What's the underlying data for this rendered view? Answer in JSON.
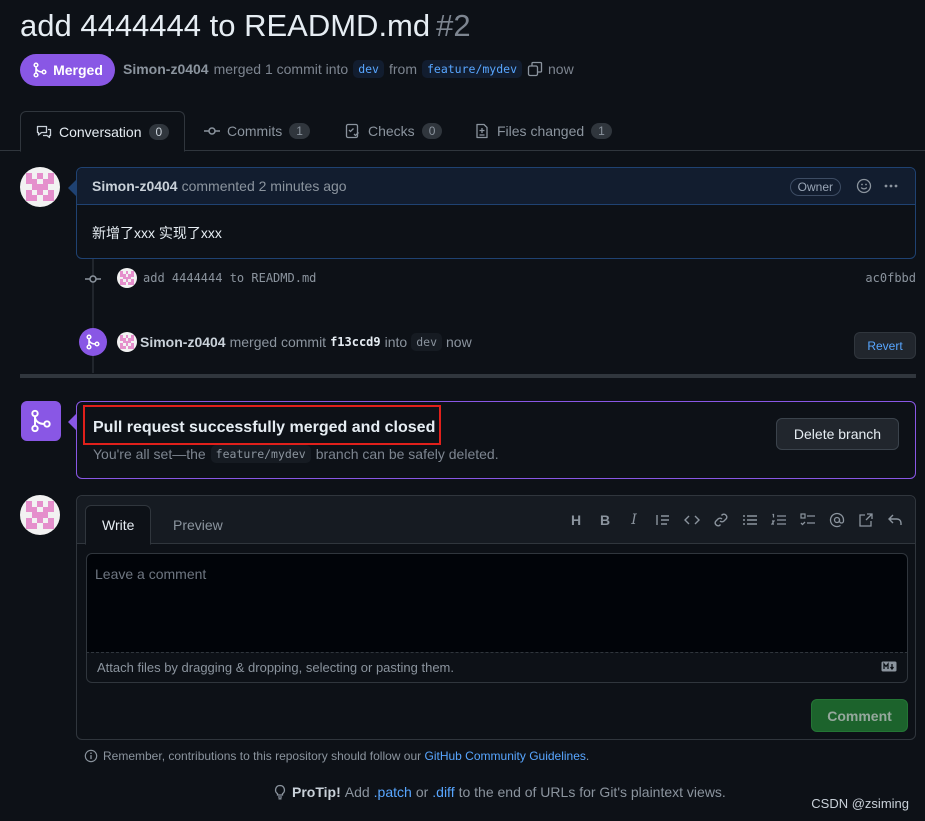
{
  "pr": {
    "title": "add 4444444 to READMD.md",
    "number": "#2",
    "state_label": "Merged",
    "author": "Simon-z0404",
    "merged_text": "merged 1 commit into",
    "base_branch": "dev",
    "from_text": "from",
    "head_branch": "feature/mydev",
    "time": "now"
  },
  "tabs": [
    {
      "label": "Conversation",
      "count": "0"
    },
    {
      "label": "Commits",
      "count": "1"
    },
    {
      "label": "Checks",
      "count": "0"
    },
    {
      "label": "Files changed",
      "count": "1"
    }
  ],
  "comment": {
    "author": "Simon-z0404",
    "action": "commented 2 minutes ago",
    "role_badge": "Owner",
    "body": "新增了xxx 实现了xxx"
  },
  "commit": {
    "message": "add 4444444 to READMD.md",
    "sha": "ac0fbbd"
  },
  "merge_event": {
    "author": "Simon-z0404",
    "text_merged": "merged commit",
    "sha": "f13ccd9",
    "text_into": "into",
    "branch": "dev",
    "time": "now",
    "revert_label": "Revert"
  },
  "merge_box": {
    "title": "Pull request successfully merged and closed",
    "sub_prefix": "You're all set—the",
    "branch": "feature/mydev",
    "sub_suffix": "branch can be safely deleted.",
    "delete_label": "Delete branch"
  },
  "editor": {
    "write_tab": "Write",
    "preview_tab": "Preview",
    "placeholder": "Leave a comment",
    "attach_text": "Attach files by dragging & dropping, selecting or pasting them.",
    "comment_label": "Comment",
    "toolbar_icons": [
      "heading-icon",
      "bold-icon",
      "italic-icon",
      "quote-icon",
      "code-icon",
      "link-icon",
      "unordered-list-icon",
      "ordered-list-icon",
      "task-list-icon",
      "mention-icon",
      "reference-icon",
      "reply-icon"
    ]
  },
  "footer": {
    "guidelines_prefix": "Remember, contributions to this repository should follow our",
    "guidelines_link": "GitHub Community Guidelines",
    "guidelines_suffix": ".",
    "protip_label": "ProTip!",
    "protip_add": "Add",
    "patch_link": ".patch",
    "or": "or",
    "diff_link": ".diff",
    "protip_rest": "to the end of URLs for Git's plaintext views."
  },
  "watermark": "CSDN @zsiming",
  "colors": {
    "background": "#0d1117",
    "merged_purple": "#8957e5",
    "link_blue": "#58a6ff",
    "comment_green": "#238636",
    "highlight_red": "#e0201b"
  }
}
